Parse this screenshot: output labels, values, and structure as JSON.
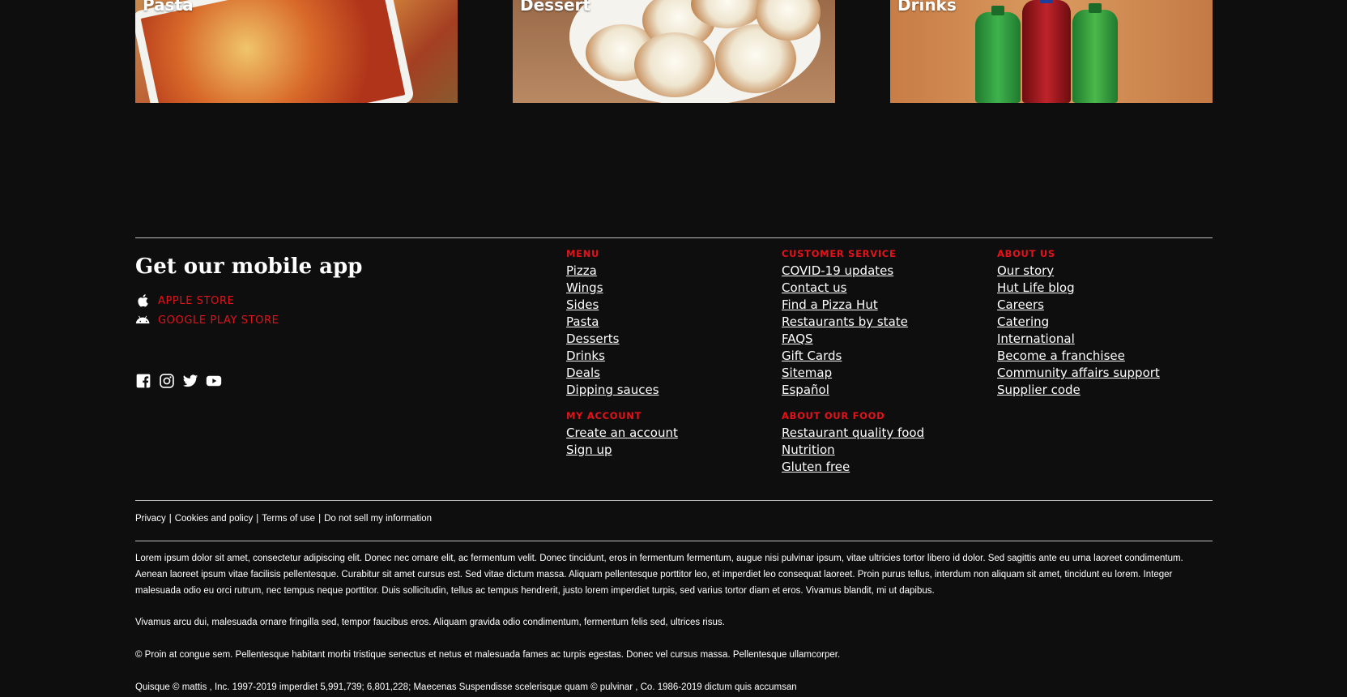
{
  "categories": [
    {
      "label": "Pasta"
    },
    {
      "label": "Dessert"
    },
    {
      "label": "Drinks"
    }
  ],
  "footer": {
    "app_title": "Get our mobile app",
    "stores": [
      {
        "label": "APPLE STORE",
        "icon": "apple-icon"
      },
      {
        "label": "GOOGLE PLAY STORE",
        "icon": "android-icon"
      }
    ],
    "social": [
      "facebook-icon",
      "instagram-icon",
      "twitter-icon",
      "youtube-icon"
    ],
    "accent_color": "#e3121b",
    "columns": [
      {
        "sections": [
          {
            "heading": "MENU",
            "links": [
              "Pizza",
              "Wings",
              "Sides",
              "Pasta",
              "Desserts",
              "Drinks",
              "Deals",
              "Dipping sauces"
            ]
          },
          {
            "heading": "MY ACCOUNT",
            "links": [
              "Create an account",
              "Sign up"
            ]
          }
        ]
      },
      {
        "sections": [
          {
            "heading": "CUSTOMER SERVICE",
            "links": [
              "COVID-19 updates",
              "Contact us",
              "Find a Pizza Hut",
              "Restaurants by state",
              "FAQS",
              "Gift Cards",
              "Sitemap",
              "Español"
            ]
          },
          {
            "heading": "ABOUT OUR FOOD",
            "links": [
              "Restaurant quality food",
              "Nutrition",
              "Gluten free"
            ]
          }
        ]
      },
      {
        "sections": [
          {
            "heading": "ABOUT US",
            "links": [
              "Our story",
              "Hut Life blog",
              "Careers",
              "Catering",
              "International",
              "Become a franchisee",
              "Community affairs support",
              "Supplier code"
            ]
          }
        ]
      }
    ],
    "legal_links": [
      "Privacy",
      "Cookies and policy",
      "Terms of use",
      "Do not sell my information"
    ],
    "legal_separator": "|",
    "paragraphs": [
      "Lorem ipsum dolor sit amet, consectetur adipiscing elit. Donec nec ornare elit, ac fermentum velit. Donec tincidunt, eros in fermentum fermentum, augue nisi pulvinar ipsum, vitae ultricies tortor libero id dolor. Sed sagittis ante eu urna laoreet condimentum. Aenean laoreet ipsum vitae facilisis pellentesque. Curabitur sit amet cursus est. Sed vitae dictum massa. Aliquam pellentesque porttitor leo, et imperdiet leo consequat laoreet. Proin purus tellus, interdum non aliquam sit amet, tincidunt eu lorem. Integer malesuada odio eu orci rutrum, nec tempus neque porttitor. Duis sollicitudin, tellus ac tempus hendrerit, justo lorem imperdiet turpis, sed varius tortor diam et eros. Vivamus blandit, mi ut dapibus.",
      "Vivamus arcu dui, malesuada ornare fringilla sed, tempor faucibus eros. Aliquam gravida odio condimentum, fermentum felis sed, ultrices risus.",
      "© Proin at congue sem. Pellentesque habitant morbi tristique senectus et netus et malesuada fames ac turpis egestas. Donec vel cursus massa. Pellentesque ullamcorper.",
      "Quisque © mattis , Inc. 1997-2019 imperdiet 5,991,739; 6,801,228; Maecenas Suspendisse scelerisque quam © pulvinar , Co. 1986-2019 dictum quis accumsan"
    ]
  }
}
